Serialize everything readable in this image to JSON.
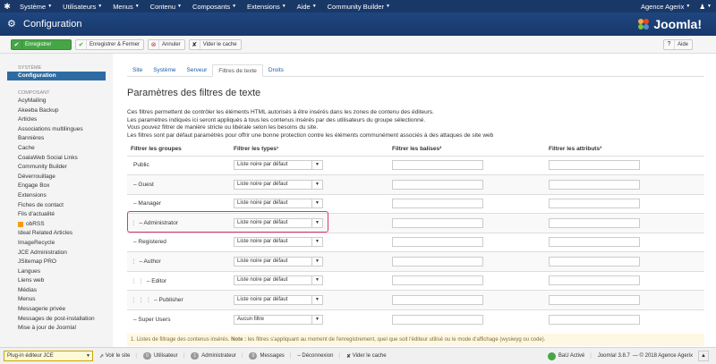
{
  "topnav": {
    "items": [
      {
        "label": "Système"
      },
      {
        "label": "Utilisateurs"
      },
      {
        "label": "Menus"
      },
      {
        "label": "Contenu"
      },
      {
        "label": "Composants"
      },
      {
        "label": "Extensions"
      },
      {
        "label": "Aide"
      },
      {
        "label": "Community Builder"
      }
    ],
    "user": "Agence Agerix"
  },
  "header": {
    "title": "Configuration",
    "brand": "Joomla!"
  },
  "toolbar": {
    "save": "Enregistrer",
    "save_close": "Enregistrer & Fermer",
    "cancel": "Annuler",
    "clear_cache": "Vider le cache",
    "help": "Aide"
  },
  "sidebar": {
    "system_head": "SYSTÈME",
    "active": "Configuration",
    "component_head": "COMPOSANT",
    "items": [
      "AcyMailing",
      "Akeeba Backup",
      "Articles",
      "Associations multilingues",
      "Bannières",
      "Cache",
      "CoalaWeb Social Links",
      "Community Builder",
      "Déverrouillage",
      "Engage Box",
      "Extensions",
      "Fiches de contact",
      "Fils d'actualité",
      "obRSS",
      "Ideal Related Articles",
      "ImageRecycle",
      "JCE Administration",
      "JSitemap PRO",
      "Langues",
      "Liens web",
      "Médias",
      "Menus",
      "Messagerie privée",
      "Messages de post-installation",
      "Mise à jour de Joomla!"
    ]
  },
  "tabs": [
    "Site",
    "Système",
    "Serveur",
    "Filtres de texte",
    "Droits"
  ],
  "section": {
    "title": "Paramètres des filtres de texte",
    "desc": [
      "Ces filtres permettent de contrôler les éléments HTML autorisés à être insérés dans les zones de contenu des éditeurs.",
      "Les paramètres indiqués ici seront appliqués à tous les contenus insérés par des utilisateurs du groupe sélectionné.",
      "Vous pouvez filtrer de manière stricte ou libérale selon les besoins du site.",
      "Les filtres sont par défaut paramétrés pour offrir une bonne protection contre les éléments communément associés à des attaques de site web"
    ]
  },
  "table": {
    "headers": [
      "Filtrer les groupes",
      "Filtrer les types¹",
      "Filtrer les balises²",
      "Filtrer les attributs³"
    ],
    "rows": [
      {
        "group": "Public",
        "dots": "",
        "type": "Liste noire par défaut"
      },
      {
        "group": "– Guest",
        "dots": "",
        "type": "Liste noire par défaut"
      },
      {
        "group": "– Manager",
        "dots": "",
        "type": "Liste noire par défaut"
      },
      {
        "group": "– Administrator",
        "dots": "⋮",
        "type": "Liste noire par défaut"
      },
      {
        "group": "– Registered",
        "dots": "",
        "type": "Liste noire par défaut"
      },
      {
        "group": "– Author",
        "dots": "⋮",
        "type": "Liste noire par défaut"
      },
      {
        "group": "– Editor",
        "dots": "⋮ ⋮",
        "type": "Liste noire par défaut"
      },
      {
        "group": "– Publisher",
        "dots": "⋮ ⋮ ⋮",
        "type": "Liste noire par défaut"
      },
      {
        "group": "– Super Users",
        "dots": "",
        "type": "Aucun filtre"
      }
    ]
  },
  "note": {
    "prefix": "1. Listes de filtrage des contenus insérés.",
    "bold": "Note :",
    "text": "les filtres s'appliquant au moment de l'enregistrement, quel que soit l'éditeur utilisé ou le mode d'affichage (wysiwyg ou code)."
  },
  "status": {
    "plugin": "Plug-in éditeur JCE",
    "view_site": "Voir le site",
    "visitors_count": "0",
    "visitors": "Utilisateur",
    "admins_count": "1",
    "admins": "Administrateur",
    "messages_count": "0",
    "messages": "Messages",
    "logout": "Déconnexion",
    "clear_cache": "Vider le cache",
    "bau": "BaU Activé",
    "version": "Joomla! 3.8.7",
    "copyright": "— © 2018 Agence Agerix"
  }
}
